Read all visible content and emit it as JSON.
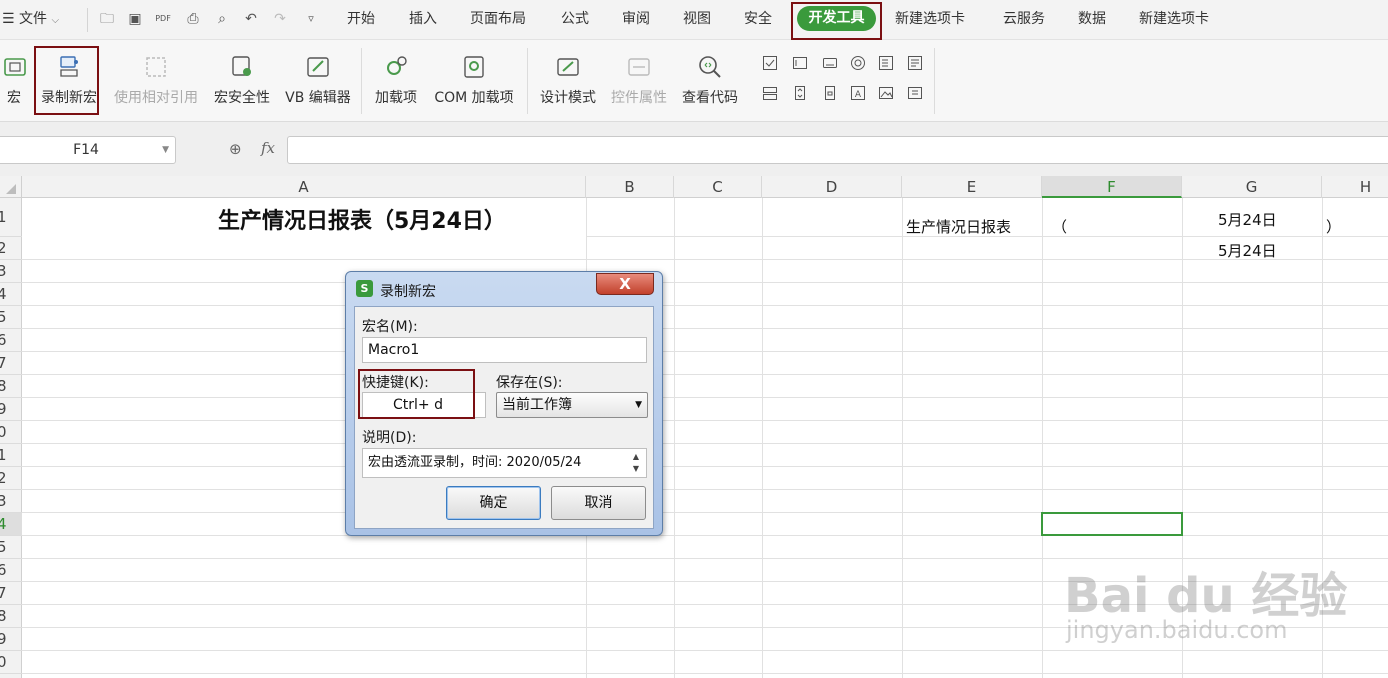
{
  "menubar": {
    "file_label": "文件",
    "tabs": [
      "开始",
      "插入",
      "页面布局",
      "公式",
      "审阅",
      "视图",
      "安全",
      "开发工具",
      "新建选项卡",
      "云服务",
      "数据",
      "新建选项卡"
    ],
    "active_tab": "开发工具",
    "quick_icons": [
      "open-icon",
      "save-icon",
      "pdf-icon",
      "print-icon",
      "print-preview-icon",
      "undo-icon",
      "redo-icon",
      "more-icon"
    ]
  },
  "ribbon": {
    "macro": "宏",
    "record_macro": "录制新宏",
    "relative_ref": "使用相对引用",
    "macro_security": "宏安全性",
    "vb_editor": "VB 编辑器",
    "addins": "加载项",
    "com_addins": "COM 加载项",
    "design_mode": "设计模式",
    "control_props": "控件属性",
    "view_code": "查看代码"
  },
  "formula_bar": {
    "name_box": "F14",
    "fx": "fx",
    "value": ""
  },
  "columns": [
    "A",
    "B",
    "C",
    "D",
    "E",
    "F",
    "G",
    "H"
  ],
  "selected_column": "F",
  "rows": [
    "1",
    "2",
    "3",
    "4",
    "5",
    "6",
    "7",
    "8",
    "9",
    "0",
    "1",
    "2",
    "3",
    "4",
    "5",
    "6",
    "7",
    "8",
    "9",
    "0"
  ],
  "selected_row_index": 13,
  "cells": {
    "a1": "生产情况日报表（5月24日）",
    "e1": "生产情况日报表",
    "f1": "（",
    "g1": "5月24日",
    "h1": "）",
    "g2": "5月24日"
  },
  "dialog": {
    "title": "录制新宏",
    "logo": "S",
    "close": "X",
    "macro_name_label": "宏名(M):",
    "macro_name_value": "Macro1",
    "shortcut_label": "快捷键(K):",
    "shortcut_value": "Ctrl+  d",
    "save_in_label": "保存在(S):",
    "save_in_value": "当前工作簿",
    "desc_label": "说明(D):",
    "desc_value": "宏由透流亚录制，时间: 2020/05/24",
    "ok": "确定",
    "cancel": "取消"
  },
  "watermark": {
    "brand": "Bai du 经验",
    "url": "jingyan.baidu.com"
  },
  "colors": {
    "accent": "#3a9a3c",
    "highlight_box": "#7b0f12"
  }
}
